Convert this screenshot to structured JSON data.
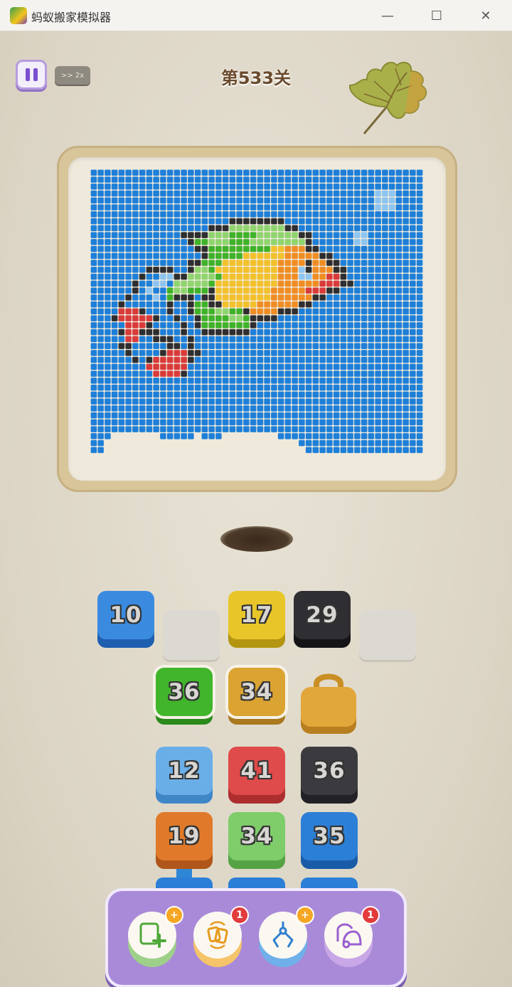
{
  "window": {
    "title": "蚂蚁搬家模拟器",
    "minimize": "—",
    "maximize": "☐",
    "close": "✕"
  },
  "hud": {
    "level": "第533关",
    "speed_label": ">>  2x"
  },
  "blocks": [
    {
      "id": "b1",
      "value": "10",
      "color": "#3a8be0",
      "dark": "#1f5fb0"
    },
    {
      "id": "b2",
      "value": "17",
      "color": "#e8c629",
      "dark": "#b39512"
    },
    {
      "id": "b3",
      "value": "29",
      "color": "#2f2f33",
      "dark": "#151517"
    },
    {
      "id": "b4",
      "value": "36",
      "color": "#41b52c",
      "dark": "#2a8a1b"
    },
    {
      "id": "b5",
      "value": "34",
      "color": "#dba332",
      "dark": "#a9781f"
    },
    {
      "id": "b6",
      "value": "12",
      "color": "#6aaee8",
      "dark": "#3f86c7"
    },
    {
      "id": "b7",
      "value": "41",
      "color": "#df4a4a",
      "dark": "#ad2e2e"
    },
    {
      "id": "b8",
      "value": "36",
      "color": "#3b3b3f",
      "dark": "#222226"
    },
    {
      "id": "b9",
      "value": "19",
      "color": "#e07a2a",
      "dark": "#b0561a"
    },
    {
      "id": "b10",
      "value": "34",
      "color": "#7fcc6a",
      "dark": "#55a345"
    },
    {
      "id": "b11",
      "value": "35",
      "color": "#2c7fd6",
      "dark": "#1a5ba8"
    }
  ],
  "tools": [
    {
      "name": "add-slot",
      "badge": "+",
      "badge_type": "plus",
      "rim": "#9ed08a"
    },
    {
      "name": "shuffle",
      "badge": "1",
      "badge_type": "count",
      "rim": "#f5c46a"
    },
    {
      "name": "claw",
      "badge": "+",
      "badge_type": "plus",
      "rim": "#6fb0ea"
    },
    {
      "name": "vacuum",
      "badge": "1",
      "badge_type": "count",
      "rim": "#c9a7e6"
    }
  ],
  "colors": {
    "pixel_blue": "#1e7fd8",
    "pixel_light_blue": "#8ec5f0",
    "pixel_black": "#2e2e30",
    "pixel_green": "#3fb22a",
    "pixel_light_green": "#8fd46e",
    "pixel_yellow": "#f2c12b",
    "pixel_orange": "#ef8d24",
    "pixel_red": "#d93a3a"
  }
}
